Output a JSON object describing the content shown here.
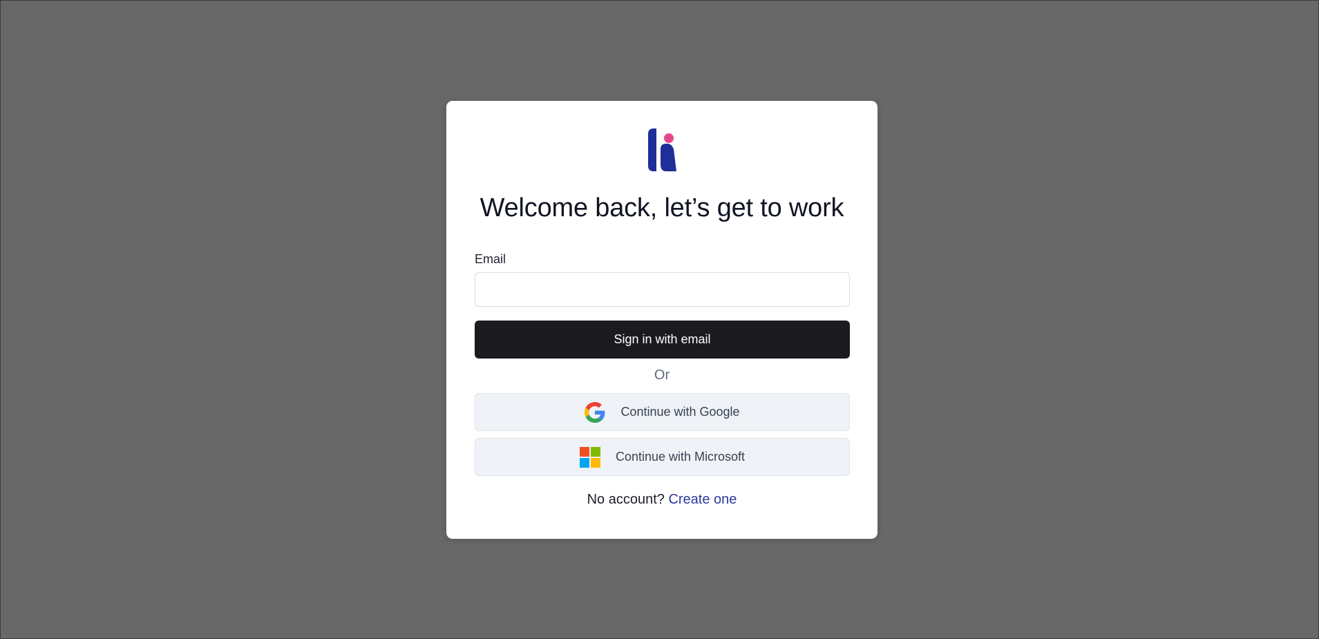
{
  "modal": {
    "logo_name": "brand-logo",
    "title": "Welcome back, let’s get to work",
    "email_label": "Email",
    "email_value": "",
    "email_placeholder": "",
    "primary_button": "Sign in with email",
    "divider_text": "Or",
    "google_button": "Continue with Google",
    "microsoft_button": "Continue with Microsoft",
    "footer_prompt": "No account?",
    "footer_link": "Create one"
  },
  "colors": {
    "overlay": "#686868",
    "card": "#ffffff",
    "primary_button_bg": "#1b1b1f",
    "sso_button_bg": "#eff2f6",
    "link": "#2b3a9e",
    "logo_blue": "#1e2f9a",
    "logo_pink": "#e8458b"
  },
  "icons": {
    "google": "google-g-icon",
    "microsoft": "microsoft-logo-icon"
  }
}
